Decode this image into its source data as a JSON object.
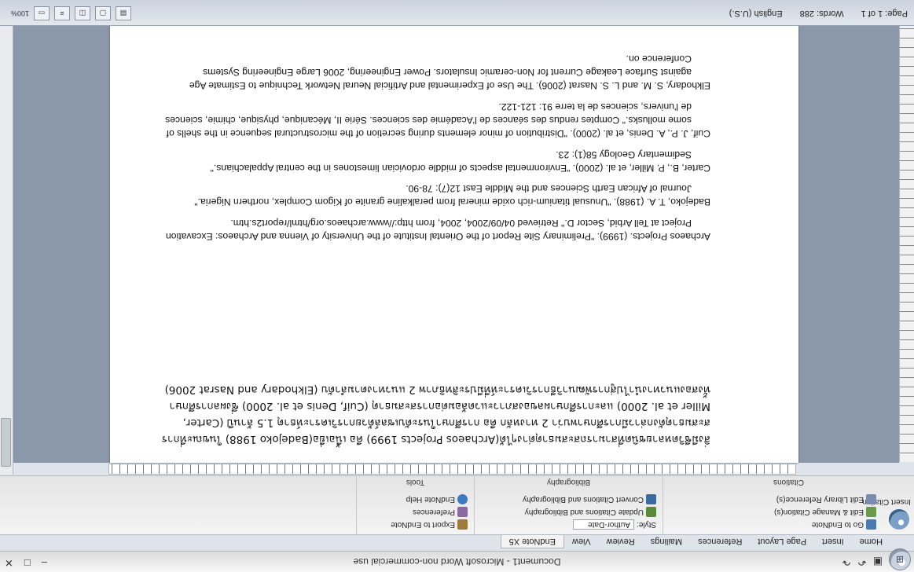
{
  "window": {
    "title": "Document1 - Microsoft Word non-commercial use",
    "office_button_icon": "office-orb-icon",
    "quick_access": [
      "save-icon",
      "undo-icon",
      "redo-icon"
    ],
    "controls": [
      "minimize-icon",
      "maximize-icon",
      "close-icon"
    ]
  },
  "ribbon": {
    "tabs": [
      "Home",
      "Insert",
      "Page Layout",
      "References",
      "Mailings",
      "Review",
      "View",
      "EndNote X5"
    ],
    "active_tab": "EndNote X5",
    "groups": {
      "citations": {
        "label": "Citations",
        "insert_citation": "Insert Citation",
        "edit_library_references": "Edit Library Reference(s)",
        "edit_manage_citations": "Edit & Manage Citation(s)",
        "go_to_endnote": "Go to EndNote"
      },
      "bibliography": {
        "label": "Bibliography",
        "style_label": "Style:",
        "style_value": "Author-Date",
        "update": "Update Citations and Bibliography",
        "convert": "Convert Citations and Bibliography"
      },
      "tools": {
        "label": "Tools",
        "export": "Export to EndNote",
        "preferences": "Preferences",
        "help": "EndNote Help"
      }
    }
  },
  "document": {
    "body_paragraph": "สิ่งมีชีวิตหลายชนิดที่สามารถสะสมธาตุต่างๆได้(Archaeos Projects 1999) คือ เนื้อเยื่อ(Badejoko 1988) ในขณะที่การสะสมธาตุดังกล่าวมีการศึกษาพบว่า 2 ทางหลัก คือ การศึกษาในระดับเซลล์ด้วยการวิเคราะห์ธาตุ 1.5 ล้านปี (Carter, Miller et al. 2000) และการศึกษาผลของสภาวะแวดล้อมต่อการสะสมธาตุ (Cuif, Denis et al. 2000) ซึ่งผลการศึกษาทั้งสองแนวทางนำไปสู่การพัฒนาวิธีการวิเคราะห์ที่มีประสิทธิภาพ 2 แนวทางตามลำดับ (Elkhodary and Nasrat 2006)",
    "references": [
      "Archaeos Projects. (1999). \"Preliminary Site Report of the Oriental Institute of the University of Vienna and Archaeos: Excavation Project at Tell Arbid, Sector D.\" Retrieved 04/09/2004, 2004, from http://www.archaeos.org/html/report2s.htm.",
      "Badejoko, T. A. (1988). \"Unusual titanium-rich oxide mineral from peralkaline granite of Kigom Complex, northern Nigeria.\" Journal of African Earth Sciences and the Middle East 12(7): 78-90.",
      "Carter, B., P. Miller, et al. (2000). \"Environmental aspects of middle ordovician limestones in the central Appalachians.\" Sedimentary Geology 58(1): 23.",
      "Cuif, J. P., A. Denis, et al. (2000). \"Distribution of minor elements during secretion of the microstructural sequence in the shells of some mollusks.\" Comptes rendus des séances de l'Académie des sciences. Série II, Mécanique, physique, chimie, sciences de l'univers, sciences de la terre 91: 121-122.",
      "Elkhodary, S. M. and L. S. Nasrat (2006). The Use of Experimental and Artificial Neural Network Technique to Estimate Age against Surface Leakage Current for Non-ceramic Insulators. Power Engineering, 2006 Large Engineering Systems Conference on."
    ]
  },
  "statusbar": {
    "page": "Page: 1 of 1",
    "words": "Words: 288",
    "language": "English (U.S.)",
    "zoom": "100%"
  }
}
